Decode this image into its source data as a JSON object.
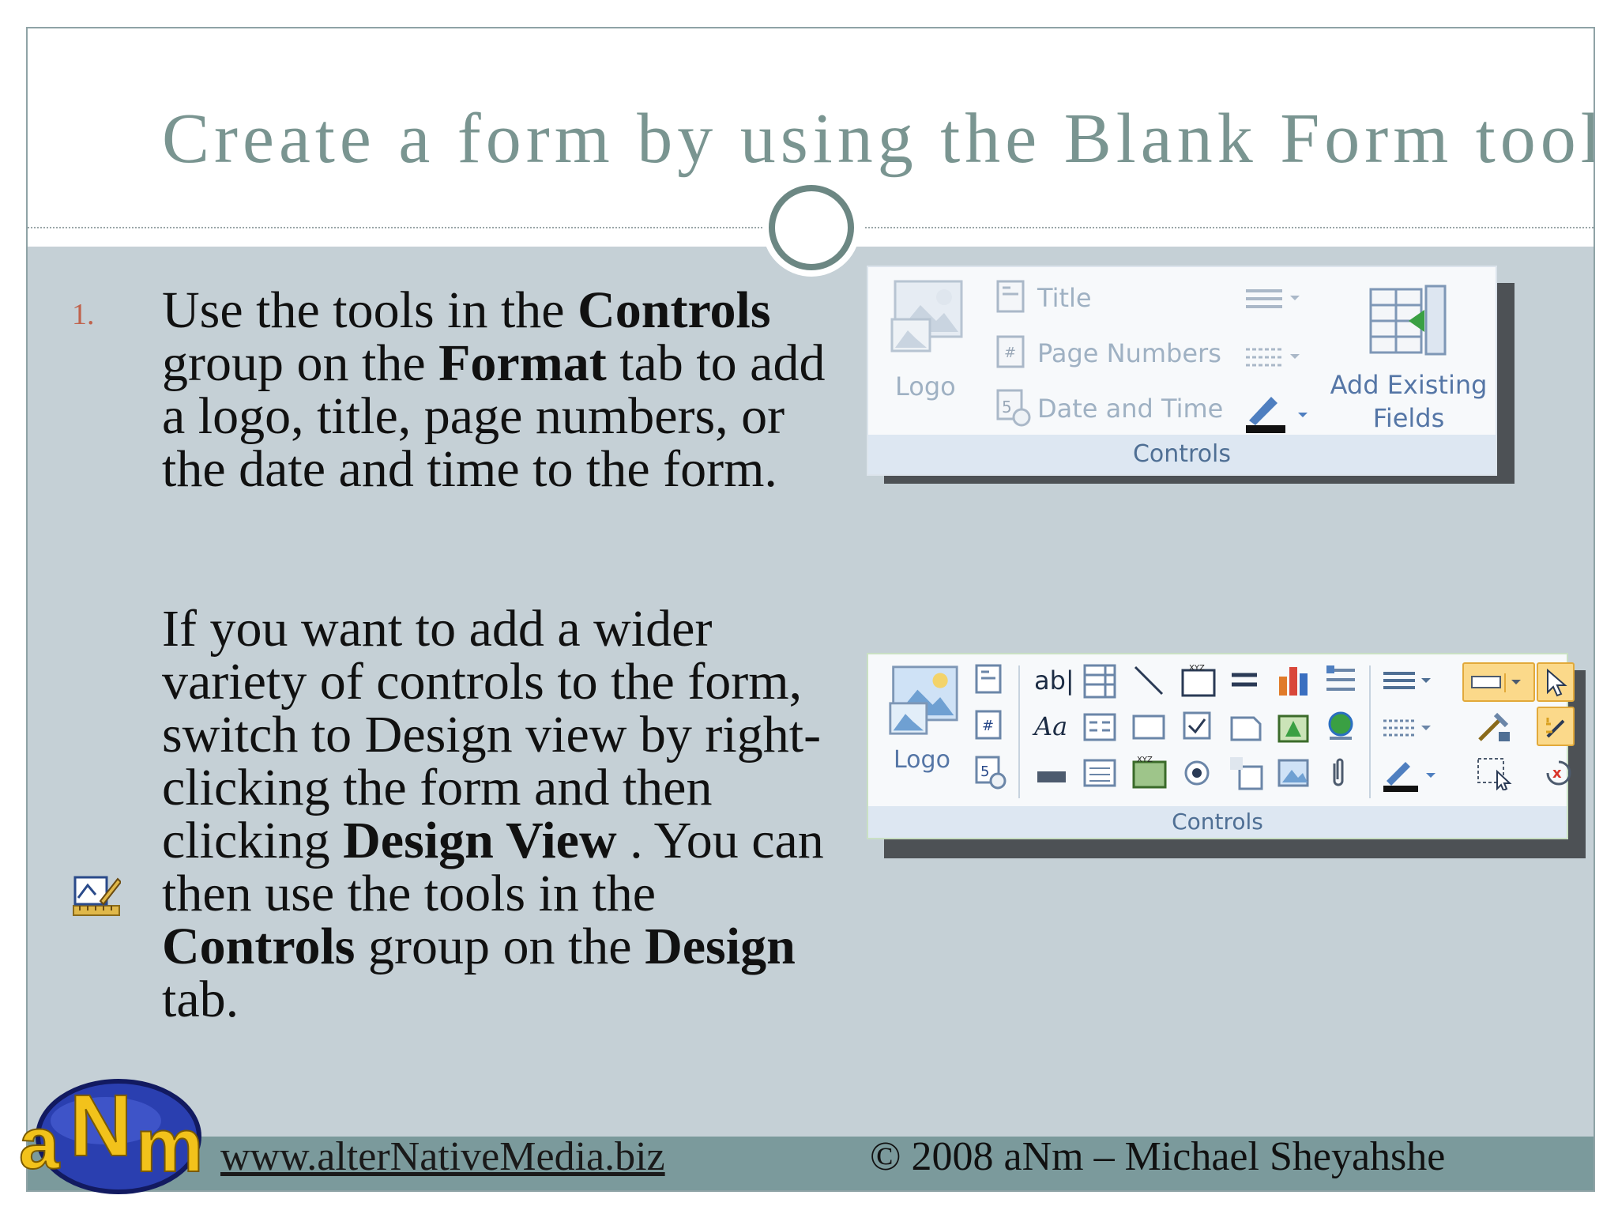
{
  "slide": {
    "title": "Create a form by using the Blank Form tool",
    "step_number": "1.",
    "paragraph1": {
      "t1": "Use the tools in the ",
      "b1": "Controls",
      "t2": " group on the ",
      "b2": "Format",
      "t3": " tab to add a logo, title, page numbers, or the date and time to the form."
    },
    "paragraph2": {
      "t1": "If you want to add a wider variety of controls to the form, switch to Design view by right-clicking the form and then clicking ",
      "b1": "Design View",
      "t2": " . You can then use the tools in the ",
      "b2": "Controls",
      "t3": " group on the ",
      "b3": "Design",
      "t4": " tab."
    }
  },
  "ribbon_format": {
    "logo_label": "Logo",
    "title_label": "Title",
    "page_numbers_label": "Page Numbers",
    "date_time_label": "Date and Time",
    "add_existing_fields_line1": "Add Existing",
    "add_existing_fields_line2": "Fields",
    "group_label": "Controls"
  },
  "ribbon_design": {
    "logo_label": "Logo",
    "group_label": "Controls",
    "text_box_glyph": "ab|",
    "label_glyph": "Aa"
  },
  "footer": {
    "website": "www.alterNativeMedia.biz",
    "copyright": "© 2008 aNm – Michael Sheyahshe"
  },
  "logo_letters": "aNm",
  "colors": {
    "title": "#7a9591",
    "body_bg": "#c5d0d6",
    "footer_band": "#7b9a9c",
    "number": "#c0634d"
  }
}
